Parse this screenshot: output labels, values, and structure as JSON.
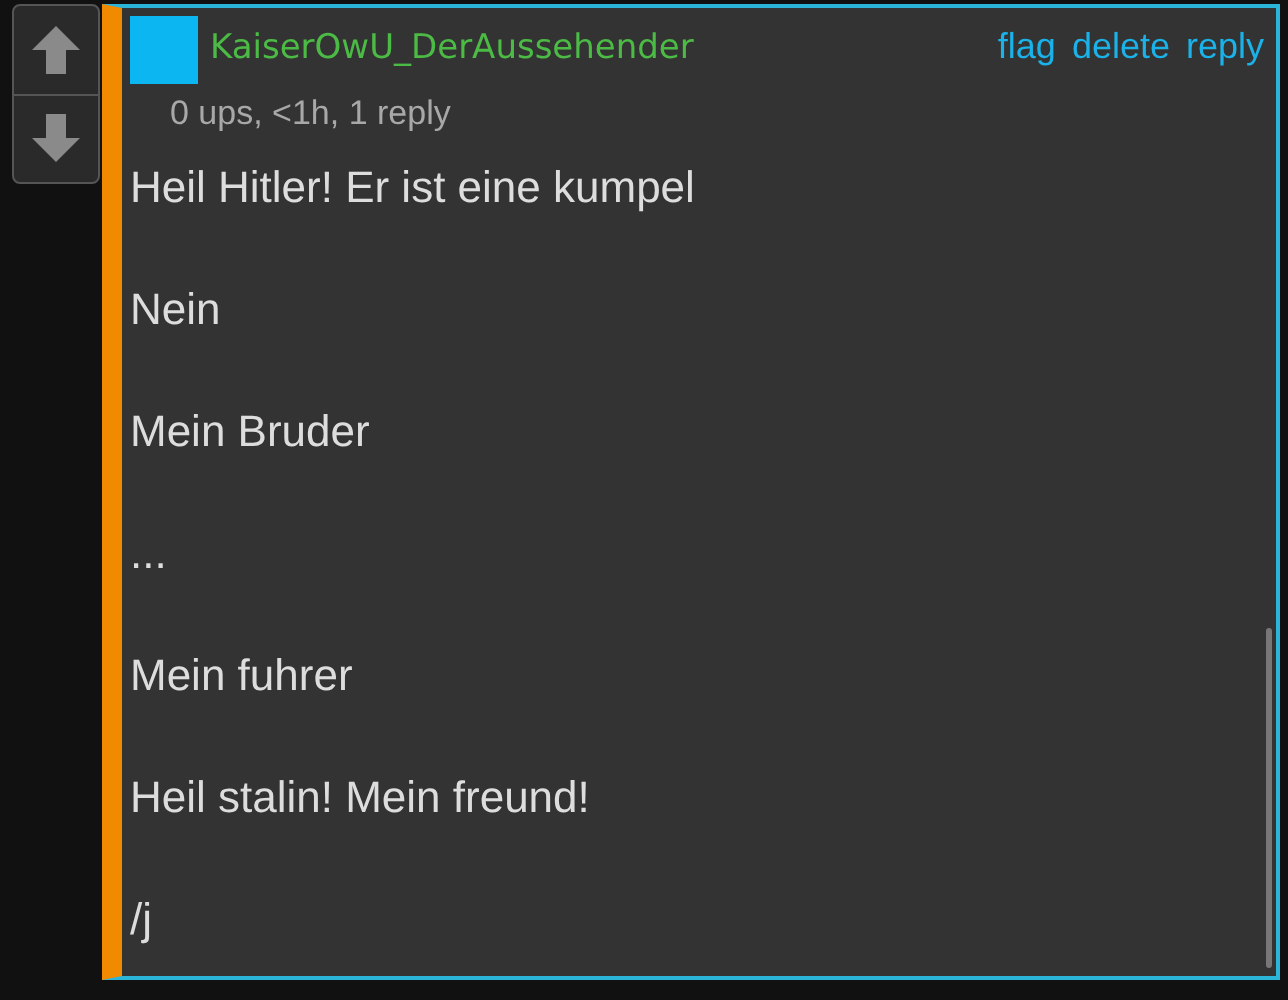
{
  "comment": {
    "username": "KaiserOwU_DerAussehender",
    "actions": [
      "flag",
      "delete",
      "reply"
    ],
    "meta": "0 ups, <1h, 1 reply",
    "paragraphs": [
      "Heil Hitler! Er ist eine kumpel",
      "Nein",
      "Mein Bruder",
      "...",
      "Mein fuhrer",
      "Heil stalin! Mein freund!",
      "/j"
    ]
  }
}
